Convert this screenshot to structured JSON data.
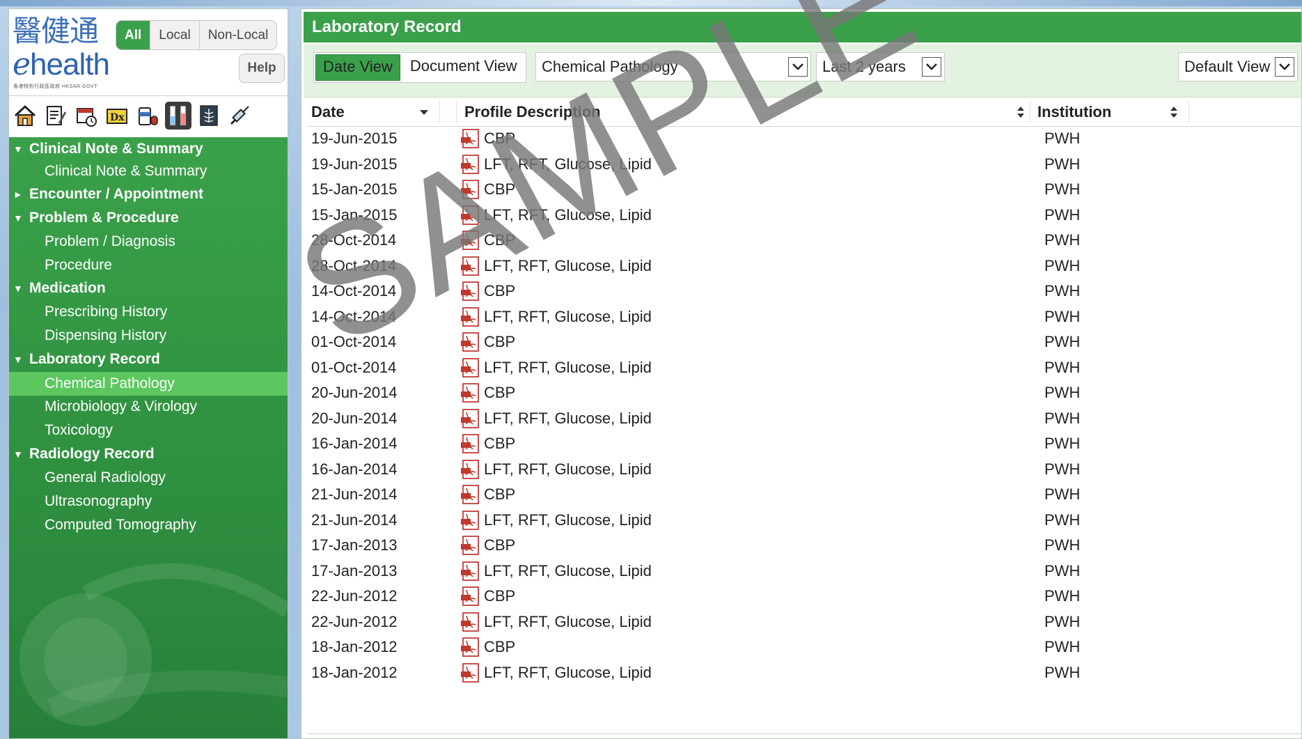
{
  "logo": {
    "chinese": "醫健通",
    "english_e": "e",
    "english_rest": "health",
    "subtitle": "香港特別行政區政府 HKSAR GOVT"
  },
  "location_filter": {
    "tabs": [
      "All",
      "Local",
      "Non-Local"
    ],
    "selected": "All"
  },
  "help_label": "Help",
  "icon_bar": [
    "home-icon",
    "clinical-note-icon",
    "appointment-icon",
    "diagnosis-icon",
    "medication-icon",
    "laboratory-icon",
    "radiology-icon",
    "procedure-icon"
  ],
  "active_icon": "laboratory-icon",
  "sidebar": {
    "items": [
      {
        "label": "Clinical Note & Summary",
        "type": "category",
        "expanded": true
      },
      {
        "label": "Clinical Note & Summary",
        "type": "sub"
      },
      {
        "label": "Encounter / Appointment",
        "type": "category",
        "expanded": false
      },
      {
        "label": "Problem & Procedure",
        "type": "category",
        "expanded": true
      },
      {
        "label": "Problem / Diagnosis",
        "type": "sub"
      },
      {
        "label": "Procedure",
        "type": "sub"
      },
      {
        "label": "Medication",
        "type": "category",
        "expanded": true
      },
      {
        "label": "Prescribing History",
        "type": "sub"
      },
      {
        "label": "Dispensing History",
        "type": "sub"
      },
      {
        "label": "Laboratory Record",
        "type": "category",
        "expanded": true
      },
      {
        "label": "Chemical Pathology",
        "type": "sub",
        "active": true
      },
      {
        "label": "Microbiology & Virology",
        "type": "sub"
      },
      {
        "label": "Toxicology",
        "type": "sub"
      },
      {
        "label": "Radiology Record",
        "type": "category",
        "expanded": true
      },
      {
        "label": "General Radiology",
        "type": "sub"
      },
      {
        "label": "Ultrasonography",
        "type": "sub"
      },
      {
        "label": "Computed Tomography",
        "type": "sub"
      }
    ]
  },
  "main": {
    "title": "Laboratory Record",
    "view_tabs": [
      "Date View",
      "Document View"
    ],
    "selected_view": "Date View",
    "category_select": "Chemical Pathology",
    "period_select": "Last 2 years",
    "layout_select": "Default View",
    "columns": [
      "Date",
      "Profile Description",
      "Institution"
    ],
    "rows": [
      {
        "date": "19-Jun-2015",
        "desc": "CBP",
        "inst": "PWH"
      },
      {
        "date": "19-Jun-2015",
        "desc": "LFT, RFT, Glucose, Lipid",
        "inst": "PWH"
      },
      {
        "date": "15-Jan-2015",
        "desc": "CBP",
        "inst": "PWH"
      },
      {
        "date": "15-Jan-2015",
        "desc": "LFT, RFT, Glucose, Lipid",
        "inst": "PWH"
      },
      {
        "date": "28-Oct-2014",
        "desc": "CBP",
        "inst": "PWH"
      },
      {
        "date": "28-Oct-2014",
        "desc": "LFT, RFT, Glucose, Lipid",
        "inst": "PWH"
      },
      {
        "date": "14-Oct-2014",
        "desc": "CBP",
        "inst": "PWH"
      },
      {
        "date": "14-Oct-2014",
        "desc": "LFT, RFT, Glucose, Lipid",
        "inst": "PWH"
      },
      {
        "date": "01-Oct-2014",
        "desc": "CBP",
        "inst": "PWH"
      },
      {
        "date": "01-Oct-2014",
        "desc": "LFT, RFT, Glucose, Lipid",
        "inst": "PWH"
      },
      {
        "date": "20-Jun-2014",
        "desc": "CBP",
        "inst": "PWH"
      },
      {
        "date": "20-Jun-2014",
        "desc": "LFT, RFT, Glucose,  Lipid",
        "inst": "PWH"
      },
      {
        "date": "16-Jan-2014",
        "desc": "CBP",
        "inst": "PWH"
      },
      {
        "date": "16-Jan-2014",
        "desc": "LFT, RFT, Glucose, Lipid",
        "inst": "PWH"
      },
      {
        "date": "21-Jun-2014",
        "desc": "CBP",
        "inst": "PWH"
      },
      {
        "date": "21-Jun-2014",
        "desc": "LFT, RFT, Glucose, Lipid",
        "inst": "PWH"
      },
      {
        "date": "17-Jan-2013",
        "desc": "CBP",
        "inst": "PWH"
      },
      {
        "date": "17-Jan-2013",
        "desc": "LFT, RFT, Glucose, Lipid",
        "inst": "PWH"
      },
      {
        "date": "22-Jun-2012",
        "desc": "CBP",
        "inst": "PWH"
      },
      {
        "date": "22-Jun-2012",
        "desc": "LFT, RFT, Glucose,  Lipid",
        "inst": "PWH"
      },
      {
        "date": "18-Jan-2012",
        "desc": "CBP",
        "inst": "PWH"
      },
      {
        "date": "18-Jan-2012",
        "desc": "LFT, RFT, Glucose, Lipid",
        "inst": "PWH"
      }
    ]
  },
  "watermark": "SAMPLE",
  "colors": {
    "brand_green": "#3aa14a",
    "active_nav": "#5cc75f",
    "toolbar_bg": "#e4f3e1",
    "pdf_red": "#c0392b"
  }
}
